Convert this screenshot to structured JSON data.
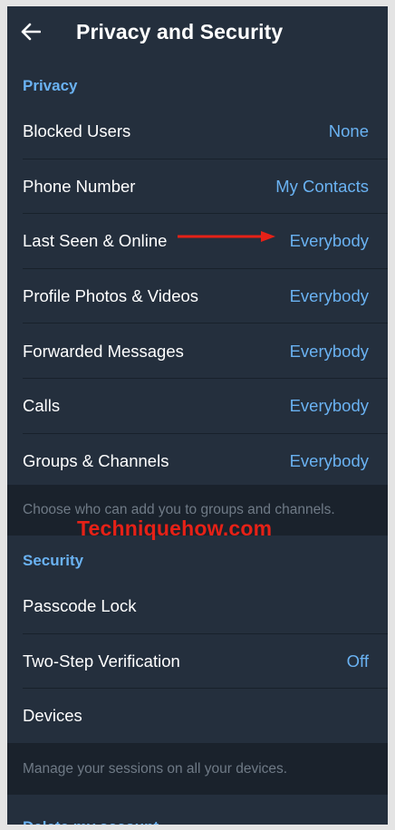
{
  "header": {
    "title": "Privacy and Security",
    "back_icon": "arrow-left-icon"
  },
  "privacy": {
    "title": "Privacy",
    "items": [
      {
        "label": "Blocked Users",
        "value": "None"
      },
      {
        "label": "Phone Number",
        "value": "My Contacts"
      },
      {
        "label": "Last Seen & Online",
        "value": "Everybody"
      },
      {
        "label": "Profile Photos & Videos",
        "value": "Everybody"
      },
      {
        "label": "Forwarded Messages",
        "value": "Everybody"
      },
      {
        "label": "Calls",
        "value": "Everybody"
      },
      {
        "label": "Groups & Channels",
        "value": "Everybody"
      }
    ],
    "hint": "Choose who can add you to groups and channels."
  },
  "security": {
    "title": "Security",
    "items": [
      {
        "label": "Passcode Lock",
        "value": ""
      },
      {
        "label": "Two-Step Verification",
        "value": "Off"
      },
      {
        "label": "Devices",
        "value": ""
      }
    ],
    "hint": "Manage your sessions on all your devices."
  },
  "delete_section": {
    "title": "Delete my account"
  },
  "annotation": {
    "watermark": "Techniquehow.com",
    "arrow_color": "#e62117"
  },
  "colors": {
    "accent": "#6ab2f2",
    "background": "#1d2733",
    "surface": "#242f3d"
  }
}
